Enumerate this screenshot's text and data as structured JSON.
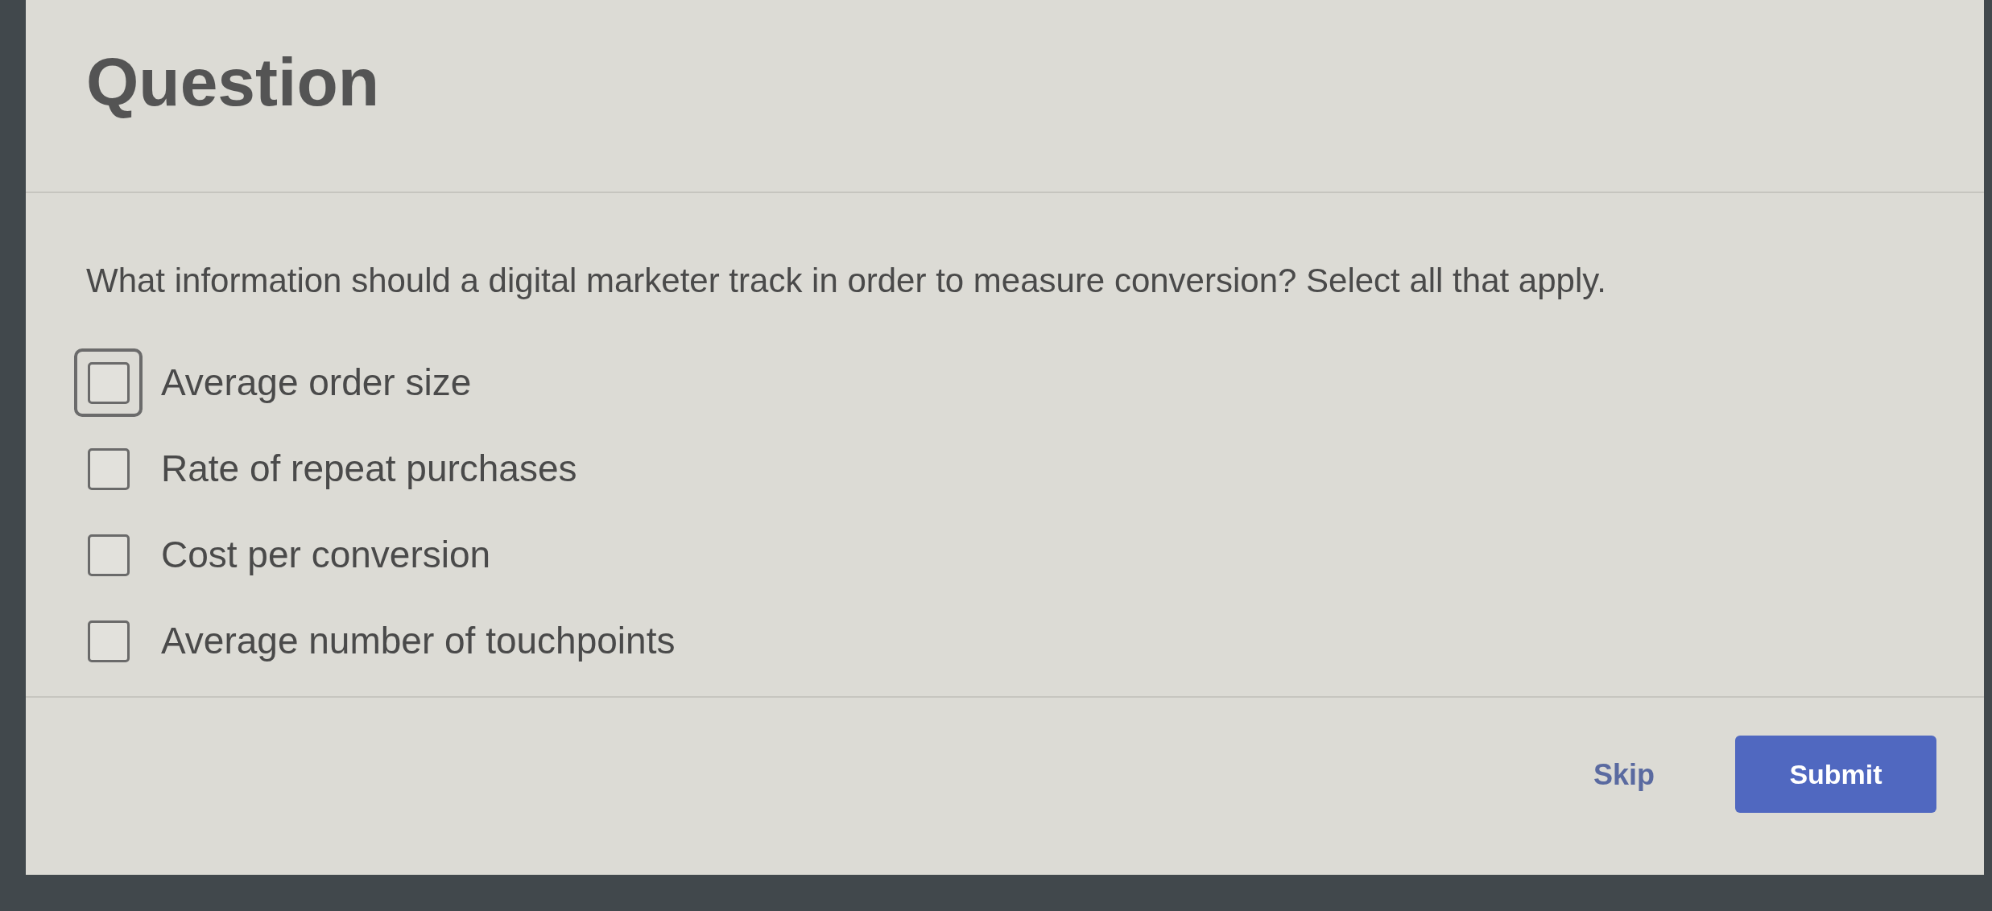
{
  "header": {
    "title": "Question"
  },
  "question": {
    "prompt": "What information should a digital marketer track in order to measure conversion? Select all that apply.",
    "options": [
      {
        "label": "Average order size",
        "checked": false,
        "focused": true
      },
      {
        "label": "Rate of repeat purchases",
        "checked": false,
        "focused": false
      },
      {
        "label": "Cost per conversion",
        "checked": false,
        "focused": false
      },
      {
        "label": "Average number of touchpoints",
        "checked": false,
        "focused": false
      }
    ]
  },
  "footer": {
    "buttons": [
      {
        "label": "Skip",
        "kind": "link"
      },
      {
        "label": "Submit",
        "kind": "primary"
      }
    ]
  }
}
